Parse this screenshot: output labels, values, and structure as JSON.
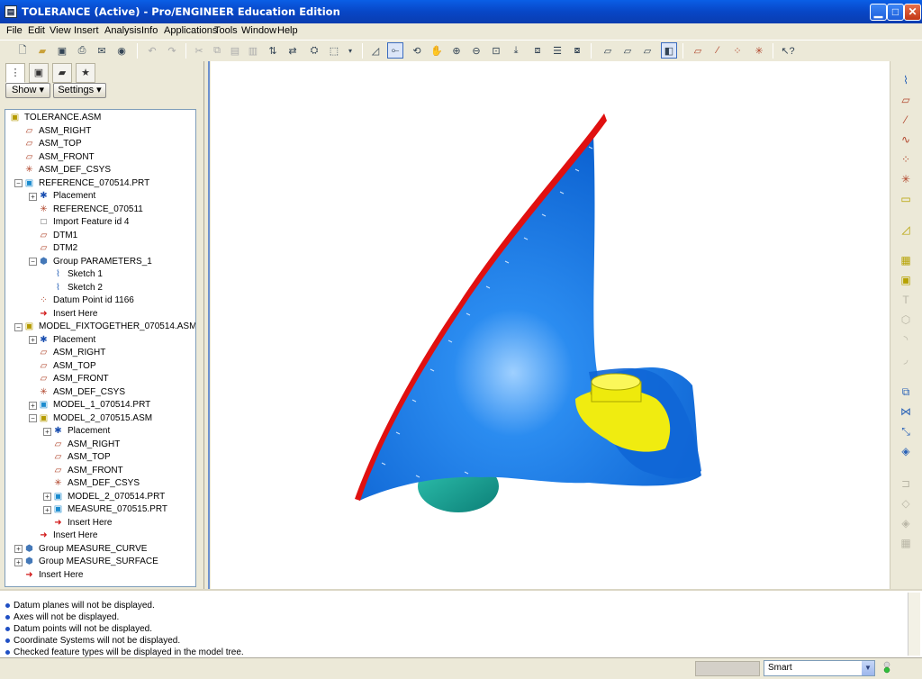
{
  "window": {
    "title": "TOLERANCE (Active) - Pro/ENGINEER Education Edition"
  },
  "menu": [
    "File",
    "Edit",
    "View",
    "Insert",
    "Analysis",
    "Info",
    "Applications",
    "Tools",
    "Window",
    "Help"
  ],
  "panel": {
    "show_label": "Show",
    "settings_label": "Settings"
  },
  "tree": [
    {
      "label": "TOLERANCE.ASM",
      "icon": "assembly-icon",
      "indent": 0,
      "expander": ""
    },
    {
      "label": "ASM_RIGHT",
      "icon": "datum-plane-icon",
      "indent": 1,
      "expander": ""
    },
    {
      "label": "ASM_TOP",
      "icon": "datum-plane-icon",
      "indent": 1,
      "expander": ""
    },
    {
      "label": "ASM_FRONT",
      "icon": "datum-plane-icon",
      "indent": 1,
      "expander": ""
    },
    {
      "label": "ASM_DEF_CSYS",
      "icon": "csys-icon",
      "indent": 1,
      "expander": ""
    },
    {
      "label": "REFERENCE_070514.PRT",
      "icon": "part-icon",
      "indent": 1,
      "expander": "−"
    },
    {
      "label": "Placement",
      "icon": "placement-icon",
      "indent": 2,
      "expander": "+"
    },
    {
      "label": "REFERENCE_070511",
      "icon": "csys-icon",
      "indent": 2,
      "expander": ""
    },
    {
      "label": "Import Feature id 4",
      "icon": "import-icon",
      "indent": 2,
      "expander": ""
    },
    {
      "label": "DTM1",
      "icon": "datum-plane-icon",
      "indent": 2,
      "expander": ""
    },
    {
      "label": "DTM2",
      "icon": "datum-plane-icon",
      "indent": 2,
      "expander": ""
    },
    {
      "label": "Group PARAMETERS_1",
      "icon": "group-icon",
      "indent": 2,
      "expander": "−"
    },
    {
      "label": "Sketch 1",
      "icon": "sketch-icon",
      "indent": 3,
      "expander": ""
    },
    {
      "label": "Sketch 2",
      "icon": "sketch-icon",
      "indent": 3,
      "expander": ""
    },
    {
      "label": "Datum Point id 1166",
      "icon": "datum-point-icon",
      "indent": 2,
      "expander": ""
    },
    {
      "label": "Insert Here",
      "icon": "insert-arrow-icon",
      "indent": 2,
      "expander": ""
    },
    {
      "label": "MODEL_FIXTOGETHER_070514.ASM",
      "icon": "assembly-icon",
      "indent": 1,
      "expander": "−"
    },
    {
      "label": "Placement",
      "icon": "placement-icon",
      "indent": 2,
      "expander": "+"
    },
    {
      "label": "ASM_RIGHT",
      "icon": "datum-plane-icon",
      "indent": 2,
      "expander": ""
    },
    {
      "label": "ASM_TOP",
      "icon": "datum-plane-icon",
      "indent": 2,
      "expander": ""
    },
    {
      "label": "ASM_FRONT",
      "icon": "datum-plane-icon",
      "indent": 2,
      "expander": ""
    },
    {
      "label": "ASM_DEF_CSYS",
      "icon": "csys-icon",
      "indent": 2,
      "expander": ""
    },
    {
      "label": "MODEL_1_070514.PRT",
      "icon": "part-icon",
      "indent": 2,
      "expander": "+"
    },
    {
      "label": "MODEL_2_070515.ASM",
      "icon": "assembly-icon",
      "indent": 2,
      "expander": "−"
    },
    {
      "label": "Placement",
      "icon": "placement-icon",
      "indent": 3,
      "expander": "+"
    },
    {
      "label": "ASM_RIGHT",
      "icon": "datum-plane-icon",
      "indent": 3,
      "expander": ""
    },
    {
      "label": "ASM_TOP",
      "icon": "datum-plane-icon",
      "indent": 3,
      "expander": ""
    },
    {
      "label": "ASM_FRONT",
      "icon": "datum-plane-icon",
      "indent": 3,
      "expander": ""
    },
    {
      "label": "ASM_DEF_CSYS",
      "icon": "csys-icon",
      "indent": 3,
      "expander": ""
    },
    {
      "label": "MODEL_2_070514.PRT",
      "icon": "part-icon",
      "indent": 3,
      "expander": "+"
    },
    {
      "label": "MEASURE_070515.PRT",
      "icon": "part-icon",
      "indent": 3,
      "expander": "+"
    },
    {
      "label": "Insert Here",
      "icon": "insert-arrow-icon",
      "indent": 3,
      "expander": ""
    },
    {
      "label": "Insert Here",
      "icon": "insert-arrow-icon",
      "indent": 2,
      "expander": ""
    },
    {
      "label": "Group MEASURE_CURVE",
      "icon": "group-icon",
      "indent": 1,
      "expander": "+"
    },
    {
      "label": "Group MEASURE_SURFACE",
      "icon": "group-icon",
      "indent": 1,
      "expander": "+"
    },
    {
      "label": "Insert Here",
      "icon": "insert-arrow-icon",
      "indent": 1,
      "expander": ""
    }
  ],
  "messages": [
    "Datum planes will not be displayed.",
    "Axes will not be displayed.",
    "Datum points will not be displayed.",
    "Coordinate Systems will not be displayed.",
    "Checked feature types will be displayed in the model tree."
  ],
  "status": {
    "filter": "Smart"
  },
  "colors": {
    "model_blue": "#1a7de8",
    "edge_red": "#e01010",
    "boss_yellow": "#f0ec10",
    "bulb_teal": "#1aa89a",
    "titlebar": "#0846c6"
  }
}
